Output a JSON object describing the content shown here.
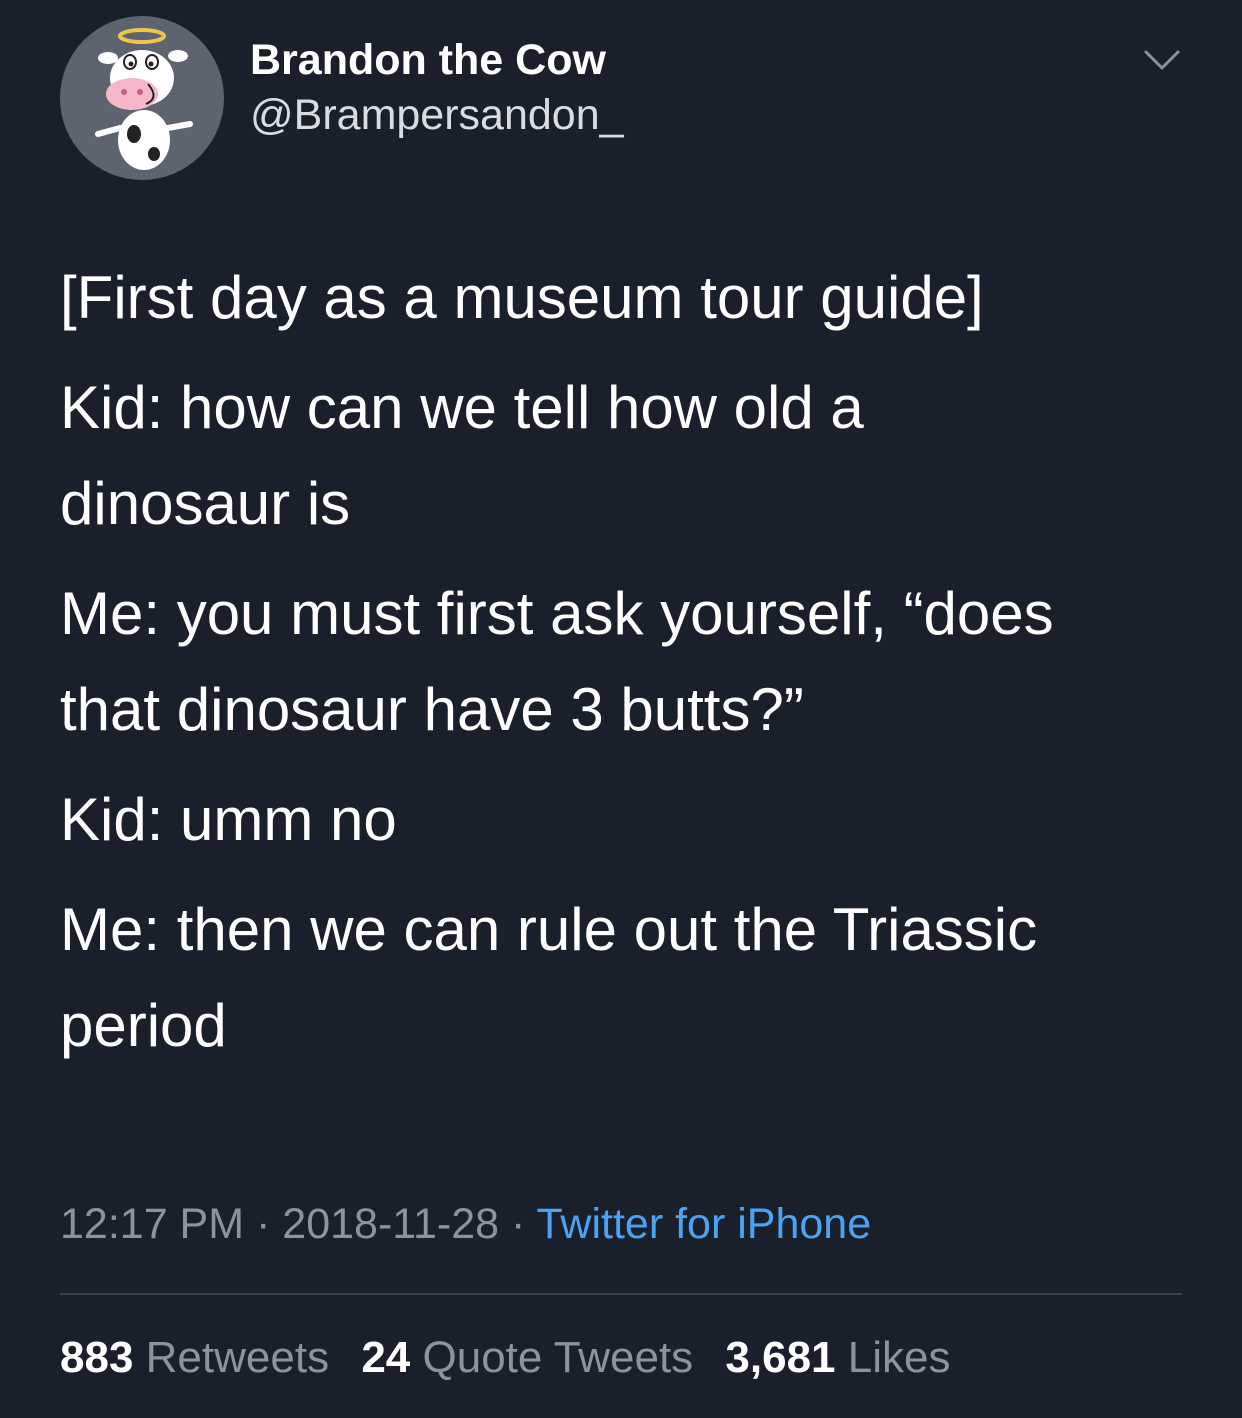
{
  "author": {
    "display_name": "Brandon the Cow",
    "handle": "@Brampersandon_",
    "avatar_icon": "cartoon-cow-halo-avatar"
  },
  "menu_icon": "chevron-down-icon",
  "tweet": {
    "paragraphs": [
      "[First day as a museum tour guide]",
      "Kid: how can we tell how old a\ndinosaur is",
      "Me: you must first ask yourself, “does\nthat dinosaur have 3 butts?”",
      "Kid: umm no",
      "Me: then we can rule out the Triassic\nperiod"
    ],
    "time": "12:17 PM",
    "separator": "·",
    "date": "2018-11-28",
    "source": "Twitter for iPhone"
  },
  "stats": {
    "retweets_count": "883",
    "retweets_label": "Retweets",
    "quotes_count": "24",
    "quotes_label": "Quote Tweets",
    "likes_count": "3,681",
    "likes_label": "Likes"
  },
  "colors": {
    "background": "#19202b",
    "text": "#ffffff",
    "secondary_text": "#8a939f",
    "link": "#4ca3f5",
    "divider": "#39414d"
  }
}
